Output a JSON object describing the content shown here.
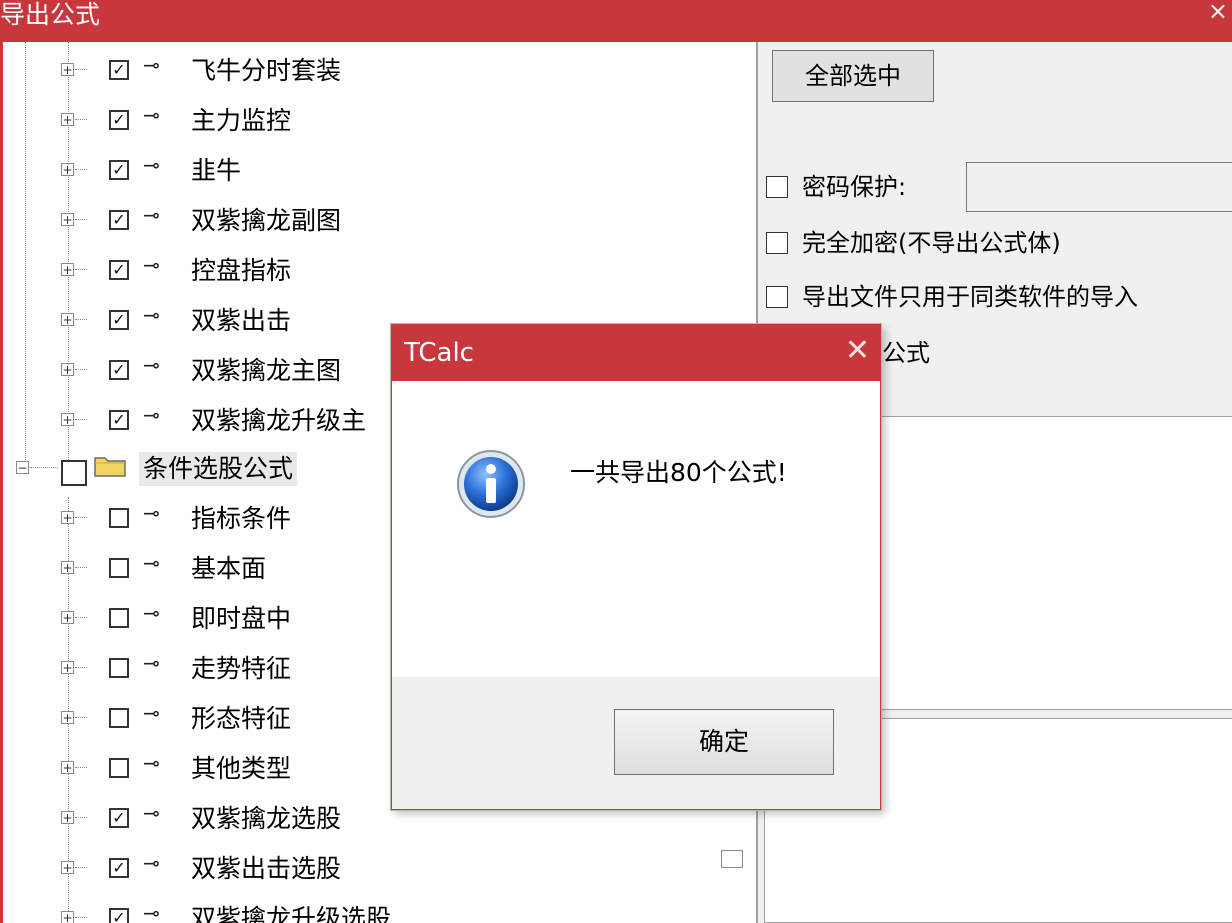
{
  "window": {
    "title": "导出公式",
    "close_glyph": "×"
  },
  "tree": {
    "items": [
      {
        "label": "飞牛分时套装",
        "checked": true
      },
      {
        "label": "主力监控",
        "checked": true
      },
      {
        "label": "韭牛",
        "checked": true
      },
      {
        "label": "双紫擒龙副图",
        "checked": true
      },
      {
        "label": "控盘指标",
        "checked": true
      },
      {
        "label": "双紫出击",
        "checked": true
      },
      {
        "label": "双紫擒龙主图",
        "checked": true
      },
      {
        "label": "双紫擒龙升级主",
        "checked": true
      },
      {
        "label": "条件选股公式",
        "checked": false
      },
      {
        "label": "指标条件",
        "checked": false
      },
      {
        "label": "基本面",
        "checked": false
      },
      {
        "label": "即时盘中",
        "checked": false
      },
      {
        "label": "走势特征",
        "checked": false
      },
      {
        "label": "形态特征",
        "checked": false
      },
      {
        "label": "其他类型",
        "checked": false
      },
      {
        "label": "双紫擒龙选股",
        "checked": true
      },
      {
        "label": "双紫出击选股",
        "checked": true
      },
      {
        "label": "双紫擒龙升级选股",
        "checked": true
      }
    ],
    "expand_glyph": "+",
    "collapse_glyph": "−",
    "check_glyph": "✓",
    "key_glyph": "⊸",
    "icons": {
      "formula": "key-icon",
      "group": "folder-icon"
    }
  },
  "right_panel": {
    "select_all": "全部选中",
    "password_label": "密码保护:",
    "password_value": "",
    "full_encrypt": "完全加密(不导出公式体)",
    "same_software_only": "导出文件只用于同类软件的导入",
    "partial_label": "公式"
  },
  "dialog": {
    "title": "TCalc",
    "close_glyph": "✕",
    "message": "一共导出80个公式!",
    "ok_label": "确定",
    "icon": "info-icon"
  },
  "colors": {
    "titlebar": "#c8373c",
    "panel_bg": "#f0f0f0",
    "info_blue": "#1a5fb4"
  }
}
